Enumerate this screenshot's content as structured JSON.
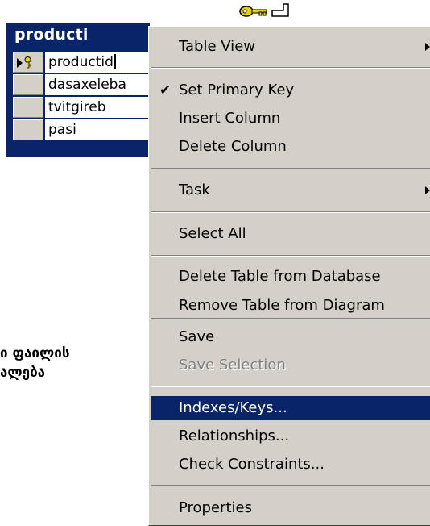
{
  "table": {
    "title": "producti",
    "columns": [
      "productid",
      "dasaxeleba",
      "tvitgireb",
      "pasi"
    ]
  },
  "context_menu": {
    "items": [
      {
        "label": "Table View",
        "submenu": true
      },
      {
        "label": "Set Primary Key",
        "checked": true
      },
      {
        "label": "Insert Column"
      },
      {
        "label": "Delete Column"
      },
      {
        "label": "Task",
        "submenu": true
      },
      {
        "label": "Select All"
      },
      {
        "label": "Delete Table from Database"
      },
      {
        "label": "Remove Table from Diagram"
      },
      {
        "label": "Save"
      },
      {
        "label": "Save Selection",
        "disabled": true
      },
      {
        "label": "Indexes/Keys...",
        "highlighted": true
      },
      {
        "label": "Relationships..."
      },
      {
        "label": "Check Constraints..."
      },
      {
        "label": "Properties"
      }
    ]
  },
  "side_text": {
    "line1": "ი ფაილის",
    "line2": "ალება"
  },
  "colors": {
    "title_bar": "#0a246a",
    "menu_bg": "#d4d0c8",
    "highlight": "#0a246a"
  },
  "icons": [
    "key-icon",
    "row-pointer-icon",
    "check-icon",
    "submenu-arrow-icon"
  ]
}
